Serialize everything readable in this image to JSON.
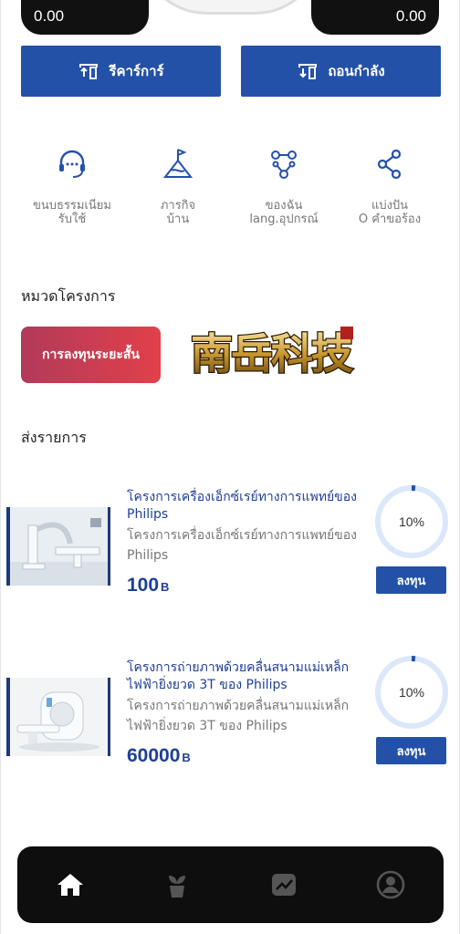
{
  "balances": {
    "left": "0.00",
    "right": "0.00"
  },
  "actions": {
    "recharge": "รีคาร์การ์",
    "withdraw": "ถอนกำลัง"
  },
  "quick_menu": [
    {
      "label": "ขนบธรรมเนียม\nรับใช้",
      "icon": "headset-icon"
    },
    {
      "label": "ภารกิจ\nบ้าน",
      "icon": "task-flag-icon"
    },
    {
      "label": "ของฉัน\nlang.อุปกรณ์",
      "icon": "network-icon"
    },
    {
      "label": "แบ่งปัน\nO คำขอร้อง",
      "icon": "share-icon"
    }
  ],
  "sections": {
    "category": "หมวดโครงการ",
    "list": "ส่งรายการ"
  },
  "category": {
    "pill": "การลงทุนระยะสั้น",
    "logo_text": "南岳科技"
  },
  "projects": [
    {
      "title": "โครงการเครื่องเอ็กซ์เรย์ทางการแพทย์ของ Philips",
      "desc": "โครงการเครื่องเอ็กซ์เรย์ทางการแพทย์ของ Philips",
      "price": "100",
      "unit": "B",
      "progress": "10%",
      "progress_value": 0.1,
      "button": "ลงทุน"
    },
    {
      "title": "โครงการถ่ายภาพด้วยคลื่นสนามแม่เหล็กไฟฟ้ายิ่งยวด 3T ของ Philips",
      "desc": "โครงการถ่ายภาพด้วยคลื่นสนามแม่เหล็กไฟฟ้ายิ่งยวด 3T ของ Philips",
      "price": "60000",
      "unit": "B",
      "progress": "10%",
      "progress_value": 0.1,
      "button": "ลงทุน"
    }
  ],
  "nav": [
    {
      "icon": "home-icon",
      "active": true
    },
    {
      "icon": "plant-icon",
      "active": false
    },
    {
      "icon": "chart-icon",
      "active": false
    },
    {
      "icon": "user-icon",
      "active": false
    }
  ],
  "colors": {
    "primary": "#2451a8",
    "title_blue": "#1f3f95",
    "progress_track": "#dbe7fb",
    "pill_start": "#b23a5a",
    "pill_end": "#e2404a"
  }
}
